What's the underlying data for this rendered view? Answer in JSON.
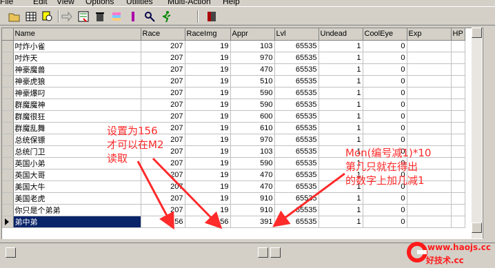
{
  "menu": [
    "File",
    "Edit",
    "View",
    "Options",
    "Utilities",
    "Multi-Action",
    "Help"
  ],
  "toolbar": [
    "open-folder-icon",
    "table-icon",
    "search-icon",
    "right-arrow-icon",
    "filter-icon",
    "trash-icon",
    "stack-icon",
    "purple-bar-icon",
    "gear-search-icon",
    "running-man-icon",
    "exit-door-icon"
  ],
  "columns": [
    "Name",
    "Race",
    "RaceImg",
    "Appr",
    "Lvl",
    "Undead",
    "CoolEye",
    "Exp",
    "HP"
  ],
  "rows": [
    [
      "吋炸小雀",
      "207",
      "19",
      "103",
      "65535",
      "1",
      "0",
      "",
      ""
    ],
    [
      "吋炸天",
      "207",
      "19",
      "970",
      "65535",
      "1",
      "0",
      "",
      ""
    ],
    [
      "神豪魔兽",
      "207",
      "19",
      "470",
      "65535",
      "1",
      "0",
      "",
      ""
    ],
    [
      "神豪虎狼",
      "207",
      "19",
      "510",
      "65535",
      "1",
      "0",
      "",
      ""
    ],
    [
      "神豪爆叼",
      "207",
      "19",
      "590",
      "65535",
      "1",
      "0",
      "",
      ""
    ],
    [
      "群魔魔神",
      "207",
      "19",
      "590",
      "65535",
      "1",
      "0",
      "",
      ""
    ],
    [
      "群魔很狂",
      "207",
      "19",
      "600",
      "65535",
      "1",
      "0",
      "",
      ""
    ],
    [
      "群魔乱舞",
      "207",
      "19",
      "610",
      "65535",
      "1",
      "0",
      "",
      ""
    ],
    [
      "总统保镖",
      "207",
      "19",
      "970",
      "65535",
      "1",
      "0",
      "",
      ""
    ],
    [
      "总统门卫",
      "207",
      "19",
      "103",
      "65535",
      "1",
      "0",
      "",
      ""
    ],
    [
      "英国小弟",
      "207",
      "19",
      "590",
      "65535",
      "1",
      "0",
      "",
      ""
    ],
    [
      "英国大哥",
      "207",
      "19",
      "470",
      "65535",
      "1",
      "0",
      "",
      ""
    ],
    [
      "美国大牛",
      "207",
      "19",
      "470",
      "65535",
      "1",
      "0",
      "",
      ""
    ],
    [
      "美国老虎",
      "207",
      "19",
      "910",
      "65535",
      "1",
      "0",
      "",
      ""
    ],
    [
      "你只是个弟弟",
      "207",
      "19",
      "910",
      "65535",
      "1",
      "0",
      "",
      ""
    ],
    [
      "弟中弟",
      "156",
      "156",
      "391",
      "65535",
      "1",
      "0",
      "",
      ""
    ]
  ],
  "selected_row": 15,
  "annotations": {
    "left": [
      "设置为156",
      "才可以在M2",
      "读取"
    ],
    "right": [
      "Mon(编号减1)*10",
      "第几只就在得出",
      "的数字上加几减1"
    ]
  },
  "watermark": {
    "line1": "www.haojs.cc",
    "line2": "好技术.cc"
  },
  "colors": {
    "annotation": "#ff2a2a",
    "selection": "#0a246a"
  }
}
